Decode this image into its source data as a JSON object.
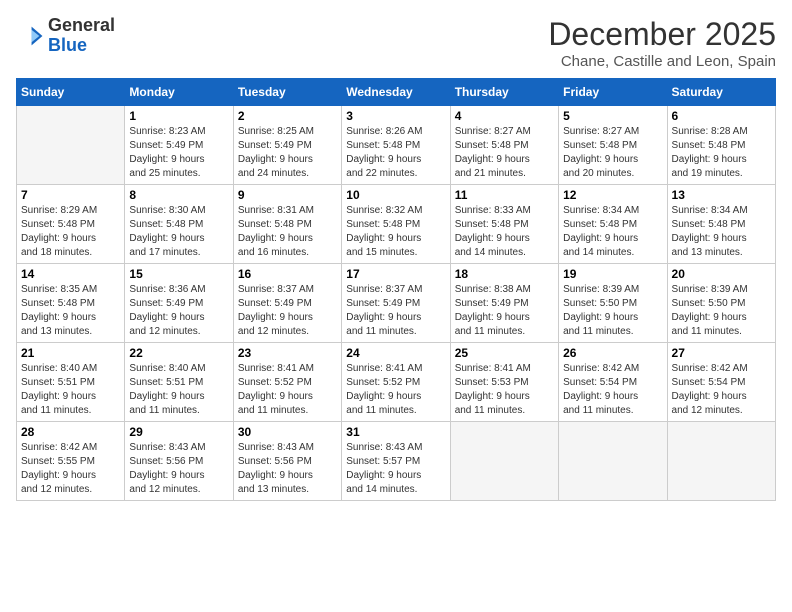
{
  "header": {
    "logo": {
      "general": "General",
      "blue": "Blue"
    },
    "month": "December 2025",
    "location": "Chane, Castille and Leon, Spain"
  },
  "weekdays": [
    "Sunday",
    "Monday",
    "Tuesday",
    "Wednesday",
    "Thursday",
    "Friday",
    "Saturday"
  ],
  "weeks": [
    [
      {
        "day": "",
        "empty": true
      },
      {
        "day": "1",
        "sunrise": "8:23 AM",
        "sunset": "5:49 PM",
        "daylight": "9 hours and 25 minutes."
      },
      {
        "day": "2",
        "sunrise": "8:25 AM",
        "sunset": "5:49 PM",
        "daylight": "9 hours and 24 minutes."
      },
      {
        "day": "3",
        "sunrise": "8:26 AM",
        "sunset": "5:48 PM",
        "daylight": "9 hours and 22 minutes."
      },
      {
        "day": "4",
        "sunrise": "8:27 AM",
        "sunset": "5:48 PM",
        "daylight": "9 hours and 21 minutes."
      },
      {
        "day": "5",
        "sunrise": "8:27 AM",
        "sunset": "5:48 PM",
        "daylight": "9 hours and 20 minutes."
      },
      {
        "day": "6",
        "sunrise": "8:28 AM",
        "sunset": "5:48 PM",
        "daylight": "9 hours and 19 minutes."
      }
    ],
    [
      {
        "day": "7",
        "sunrise": "8:29 AM",
        "sunset": "5:48 PM",
        "daylight": "9 hours and 18 minutes."
      },
      {
        "day": "8",
        "sunrise": "8:30 AM",
        "sunset": "5:48 PM",
        "daylight": "9 hours and 17 minutes."
      },
      {
        "day": "9",
        "sunrise": "8:31 AM",
        "sunset": "5:48 PM",
        "daylight": "9 hours and 16 minutes."
      },
      {
        "day": "10",
        "sunrise": "8:32 AM",
        "sunset": "5:48 PM",
        "daylight": "9 hours and 15 minutes."
      },
      {
        "day": "11",
        "sunrise": "8:33 AM",
        "sunset": "5:48 PM",
        "daylight": "9 hours and 14 minutes."
      },
      {
        "day": "12",
        "sunrise": "8:34 AM",
        "sunset": "5:48 PM",
        "daylight": "9 hours and 14 minutes."
      },
      {
        "day": "13",
        "sunrise": "8:34 AM",
        "sunset": "5:48 PM",
        "daylight": "9 hours and 13 minutes."
      }
    ],
    [
      {
        "day": "14",
        "sunrise": "8:35 AM",
        "sunset": "5:48 PM",
        "daylight": "9 hours and 13 minutes."
      },
      {
        "day": "15",
        "sunrise": "8:36 AM",
        "sunset": "5:49 PM",
        "daylight": "9 hours and 12 minutes."
      },
      {
        "day": "16",
        "sunrise": "8:37 AM",
        "sunset": "5:49 PM",
        "daylight": "9 hours and 12 minutes."
      },
      {
        "day": "17",
        "sunrise": "8:37 AM",
        "sunset": "5:49 PM",
        "daylight": "9 hours and 11 minutes."
      },
      {
        "day": "18",
        "sunrise": "8:38 AM",
        "sunset": "5:49 PM",
        "daylight": "9 hours and 11 minutes."
      },
      {
        "day": "19",
        "sunrise": "8:39 AM",
        "sunset": "5:50 PM",
        "daylight": "9 hours and 11 minutes."
      },
      {
        "day": "20",
        "sunrise": "8:39 AM",
        "sunset": "5:50 PM",
        "daylight": "9 hours and 11 minutes."
      }
    ],
    [
      {
        "day": "21",
        "sunrise": "8:40 AM",
        "sunset": "5:51 PM",
        "daylight": "9 hours and 11 minutes."
      },
      {
        "day": "22",
        "sunrise": "8:40 AM",
        "sunset": "5:51 PM",
        "daylight": "9 hours and 11 minutes."
      },
      {
        "day": "23",
        "sunrise": "8:41 AM",
        "sunset": "5:52 PM",
        "daylight": "9 hours and 11 minutes."
      },
      {
        "day": "24",
        "sunrise": "8:41 AM",
        "sunset": "5:52 PM",
        "daylight": "9 hours and 11 minutes."
      },
      {
        "day": "25",
        "sunrise": "8:41 AM",
        "sunset": "5:53 PM",
        "daylight": "9 hours and 11 minutes."
      },
      {
        "day": "26",
        "sunrise": "8:42 AM",
        "sunset": "5:54 PM",
        "daylight": "9 hours and 11 minutes."
      },
      {
        "day": "27",
        "sunrise": "8:42 AM",
        "sunset": "5:54 PM",
        "daylight": "9 hours and 12 minutes."
      }
    ],
    [
      {
        "day": "28",
        "sunrise": "8:42 AM",
        "sunset": "5:55 PM",
        "daylight": "9 hours and 12 minutes."
      },
      {
        "day": "29",
        "sunrise": "8:43 AM",
        "sunset": "5:56 PM",
        "daylight": "9 hours and 12 minutes."
      },
      {
        "day": "30",
        "sunrise": "8:43 AM",
        "sunset": "5:56 PM",
        "daylight": "9 hours and 13 minutes."
      },
      {
        "day": "31",
        "sunrise": "8:43 AM",
        "sunset": "5:57 PM",
        "daylight": "9 hours and 14 minutes."
      },
      {
        "day": "",
        "empty": true
      },
      {
        "day": "",
        "empty": true
      },
      {
        "day": "",
        "empty": true
      }
    ]
  ],
  "labels": {
    "sunrise": "Sunrise:",
    "sunset": "Sunset:",
    "daylight": "Daylight:"
  }
}
